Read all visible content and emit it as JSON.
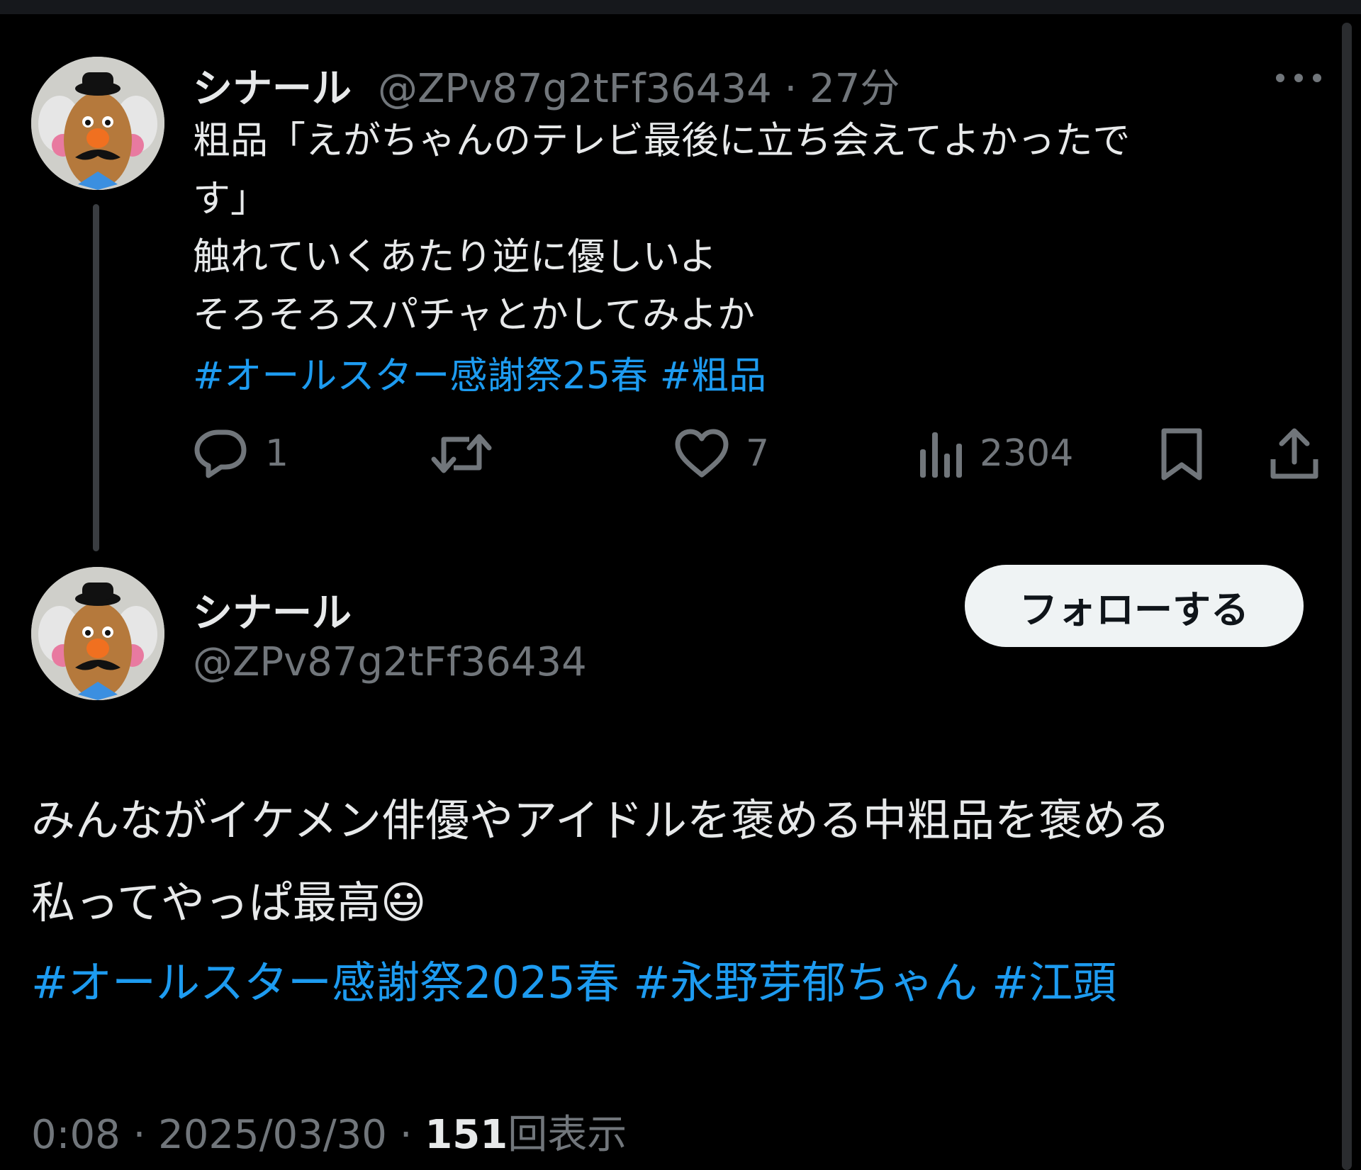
{
  "tweet1": {
    "display_name": "シナール",
    "handle": "@ZPv87g2tFf36434",
    "sep": " · ",
    "time": "27分",
    "lines": [
      "粗品「えがちゃんのテレビ最後に立ち会えてよかったで",
      "す」",
      "触れていくあたり逆に優しいよ",
      "そろそろスパチャとかしてみよか"
    ],
    "hashtags": [
      "#オールスター感謝祭25春",
      "#粗品"
    ],
    "actions": {
      "reply_count": "1",
      "like_count": "7",
      "views_count": "2304"
    }
  },
  "tweet2": {
    "display_name": "シナール",
    "handle": "@ZPv87g2tFf36434",
    "follow_label": "フォローする",
    "lines": [
      "みんながイケメン俳優やアイドルを褒める中粗品を褒める",
      "私ってやっぱ最高😃"
    ],
    "hashtags": [
      "#オールスター感謝祭2025春",
      "#永野芽郁ちゃん",
      "#江頭"
    ],
    "meta": {
      "time": "0:08",
      "sep": " · ",
      "date": "2025/03/30",
      "views_num": "151",
      "views_label": "回表示"
    }
  },
  "colors": {
    "background": "#000000",
    "text": "#e7e9ea",
    "muted": "#71767b",
    "link": "#1d9bf0",
    "follow_bg": "#eff3f4"
  },
  "icons": [
    "avatar",
    "more-icon",
    "reply-icon",
    "retweet-icon",
    "like-icon",
    "views-icon",
    "bookmark-icon",
    "share-icon"
  ]
}
